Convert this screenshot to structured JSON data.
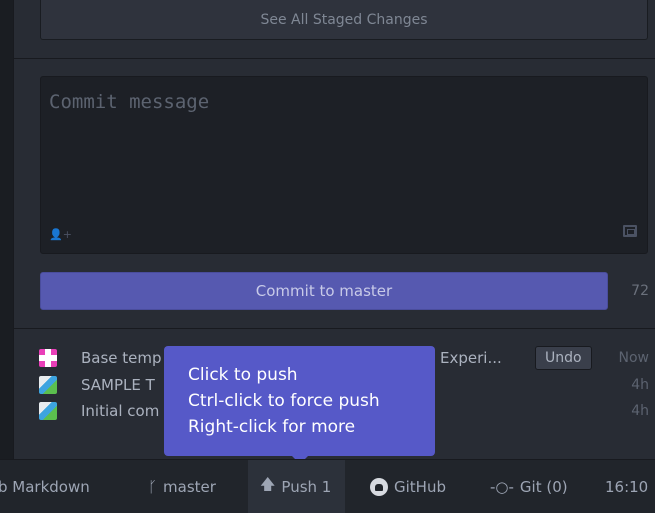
{
  "staged": {
    "see_all_label": "See All Staged Changes"
  },
  "commit": {
    "placeholder": "Commit message",
    "button_label": "Commit to master",
    "char_count": "72"
  },
  "commits": [
    {
      "avatar": "pink-identicon",
      "message": "Base temp",
      "message_tail": "Experi...",
      "undo_label": "Undo",
      "time": "Now"
    },
    {
      "avatar": "image-avatar",
      "message": "SAMPLE T",
      "time": "4h"
    },
    {
      "avatar": "image-avatar",
      "message": "Initial com",
      "time": "4h"
    }
  ],
  "tooltip": {
    "line1": "Click to push",
    "line2": "Ctrl-click to force push",
    "line3": "Right-click for more"
  },
  "status_bar": {
    "grammar": "b Markdown",
    "branch": "master",
    "push": "Push 1",
    "github": "GitHub",
    "git": "Git (0)",
    "clock": "16:10"
  },
  "colors": {
    "accent": "#5659b0",
    "tooltip": "#5659c8",
    "background": "#282c34"
  }
}
